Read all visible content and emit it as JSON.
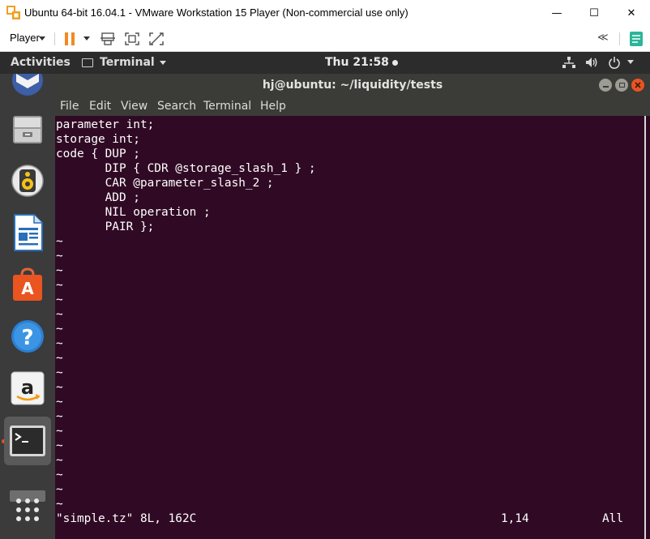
{
  "window": {
    "title": "Ubuntu 64-bit 16.04.1 - VMware Workstation 15 Player (Non-commercial use only)",
    "minimize": "—",
    "maximize": "☐",
    "close": "✕"
  },
  "toolbar": {
    "player_label": "Player",
    "collapse_glyph": "≪"
  },
  "topbar": {
    "activities": "Activities",
    "app_name": "Terminal",
    "clock": "Thu 21:58"
  },
  "dock": {
    "items": [
      "thunderbird",
      "files",
      "rhythmbox",
      "libreoffice-writer",
      "ubuntu-software",
      "help",
      "amazon",
      "terminal",
      "ubuntu-one",
      "show-applications"
    ],
    "active": "terminal"
  },
  "terminal": {
    "title": "hj@ubuntu: ~/liquidity/tests",
    "menu": [
      "File",
      "Edit",
      "View",
      "Search",
      "Terminal",
      "Help"
    ],
    "lines": [
      "parameter int;",
      "storage int;",
      "code { DUP ;",
      "       DIP { CDR @storage_slash_1 } ;",
      "       CAR @parameter_slash_2 ;",
      "       ADD ;",
      "       NIL operation ;",
      "       PAIR };"
    ],
    "tilde": "~",
    "status": {
      "file_info": "\"simple.tz\" 8L, 162C",
      "position": "1,14",
      "scroll": "All"
    }
  },
  "colors": {
    "terminal_bg": "#300a24",
    "terminal_fg": "#ffffff",
    "chrome_bg": "#3b3b37",
    "topbar_bg": "#2c2c2c",
    "dock_bg": "#3b3b3b",
    "accent": "#e95420"
  }
}
